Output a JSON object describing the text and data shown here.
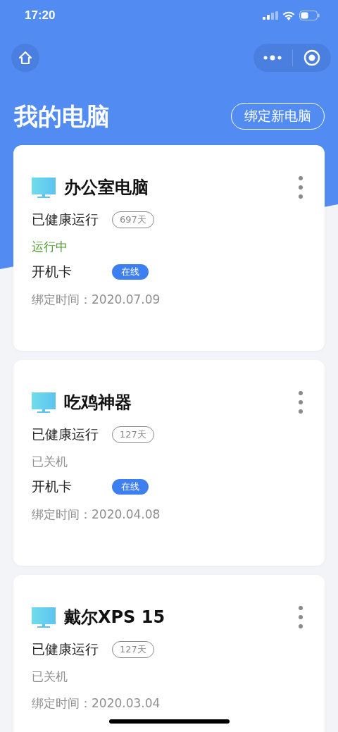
{
  "status_bar": {
    "time": "17:20"
  },
  "page": {
    "title": "我的电脑",
    "bind_button": "绑定新电脑"
  },
  "devices": [
    {
      "name": "办公室电脑",
      "health_label": "已健康运行",
      "days": "697天",
      "status": {
        "text": "运行中",
        "kind": "running"
      },
      "card": {
        "label": "开机卡",
        "badge": "在线"
      },
      "bind_time": "绑定时间：2020.07.09"
    },
    {
      "name": "吃鸡神器",
      "health_label": "已健康运行",
      "days": "127天",
      "status": {
        "text": "已关机",
        "kind": "off"
      },
      "card": {
        "label": "开机卡",
        "badge": "在线"
      },
      "bind_time": "绑定时间：2020.04.08"
    },
    {
      "name": "戴尔XPS 15",
      "health_label": "已健康运行",
      "days": "127天",
      "status": {
        "text": "已关机",
        "kind": "off"
      },
      "bind_time": "绑定时间：2020.03.04"
    }
  ]
}
